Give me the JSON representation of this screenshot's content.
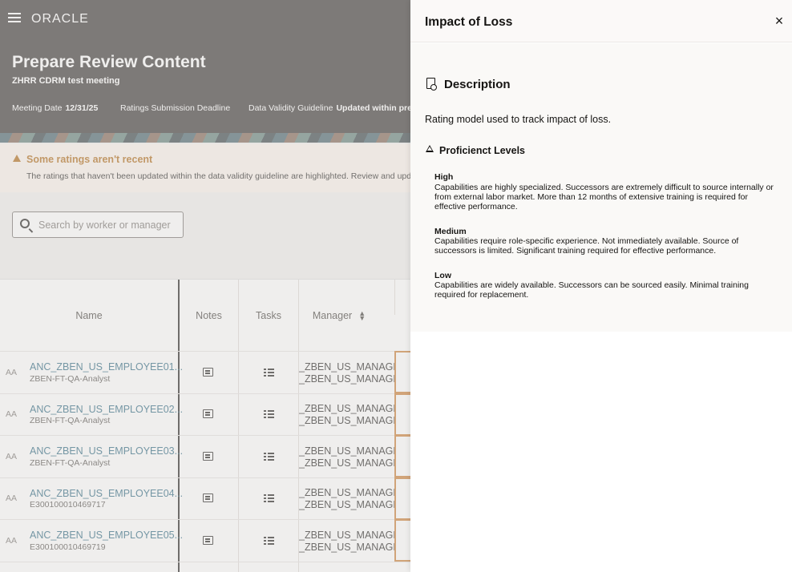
{
  "header": {
    "brand": "ORACLE",
    "title": "Prepare Review Content",
    "subtitle": "ZHRR CDRM test meeting",
    "meeting_date_label": "Meeting Date",
    "meeting_date_value": "12/31/25",
    "ratings_deadline_label": "Ratings Submission Deadline",
    "validity_label": "Data Validity Guideline",
    "validity_value": "Updated within pre"
  },
  "banner": {
    "title": "Some ratings aren't recent",
    "text": "The ratings that haven't been updated within the data validity guideline are highlighted. Review and upd"
  },
  "search": {
    "placeholder": "Search by worker or manager",
    "value": ""
  },
  "table": {
    "columns": [
      "Name",
      "Notes",
      "Tasks",
      "Manager"
    ],
    "rows": [
      {
        "initials": "AA",
        "name": "ANC_ZBEN_US_EMPLOYEE01...",
        "job": "ZBEN-FT-QA-Analyst",
        "mgr1": "_ZBEN_US_MANAGE",
        "mgr2": "_ZBEN_US_MANAGE"
      },
      {
        "initials": "AA",
        "name": "ANC_ZBEN_US_EMPLOYEE02...",
        "job": "ZBEN-FT-QA-Analyst",
        "mgr1": "_ZBEN_US_MANAGE",
        "mgr2": "_ZBEN_US_MANAGE"
      },
      {
        "initials": "AA",
        "name": "ANC_ZBEN_US_EMPLOYEE03...",
        "job": "ZBEN-FT-QA-Analyst",
        "mgr1": "_ZBEN_US_MANAGE",
        "mgr2": "_ZBEN_US_MANAGE"
      },
      {
        "initials": "AA",
        "name": "ANC_ZBEN_US_EMPLOYEE04...",
        "job": "E300100010469717",
        "mgr1": "_ZBEN_US_MANAGE",
        "mgr2": "_ZBEN_US_MANAGE"
      },
      {
        "initials": "AA",
        "name": "ANC_ZBEN_US_EMPLOYEE05...",
        "job": "E300100010469719",
        "mgr1": "_ZBEN_US_MANAGE",
        "mgr2": "_ZBEN_US_MANAGE"
      }
    ]
  },
  "drawer": {
    "title": "Impact of Loss",
    "close_label": "×",
    "description_heading": "Description",
    "description_text": "Rating model used to track impact of loss.",
    "proficiency_heading": "Proficienct Levels",
    "levels": [
      {
        "name": "High",
        "desc": "Capabilities are highly specialized. Successors are extremely difficult to source internally or from external labor market. More than 12 months of extensive training is required for effective performance."
      },
      {
        "name": "Medium",
        "desc": "Capabilities require role-specific experience. Not immediately available. Source of successors is limited. Significant training required for effective performance."
      },
      {
        "name": "Low",
        "desc": "Capabilities are widely available. Successors can be sourced easily. Minimal training required for replacement."
      }
    ]
  },
  "colors": {
    "accent": "#1f5f7a",
    "warning": "#ac630c",
    "header_bg": "#312d2a"
  }
}
